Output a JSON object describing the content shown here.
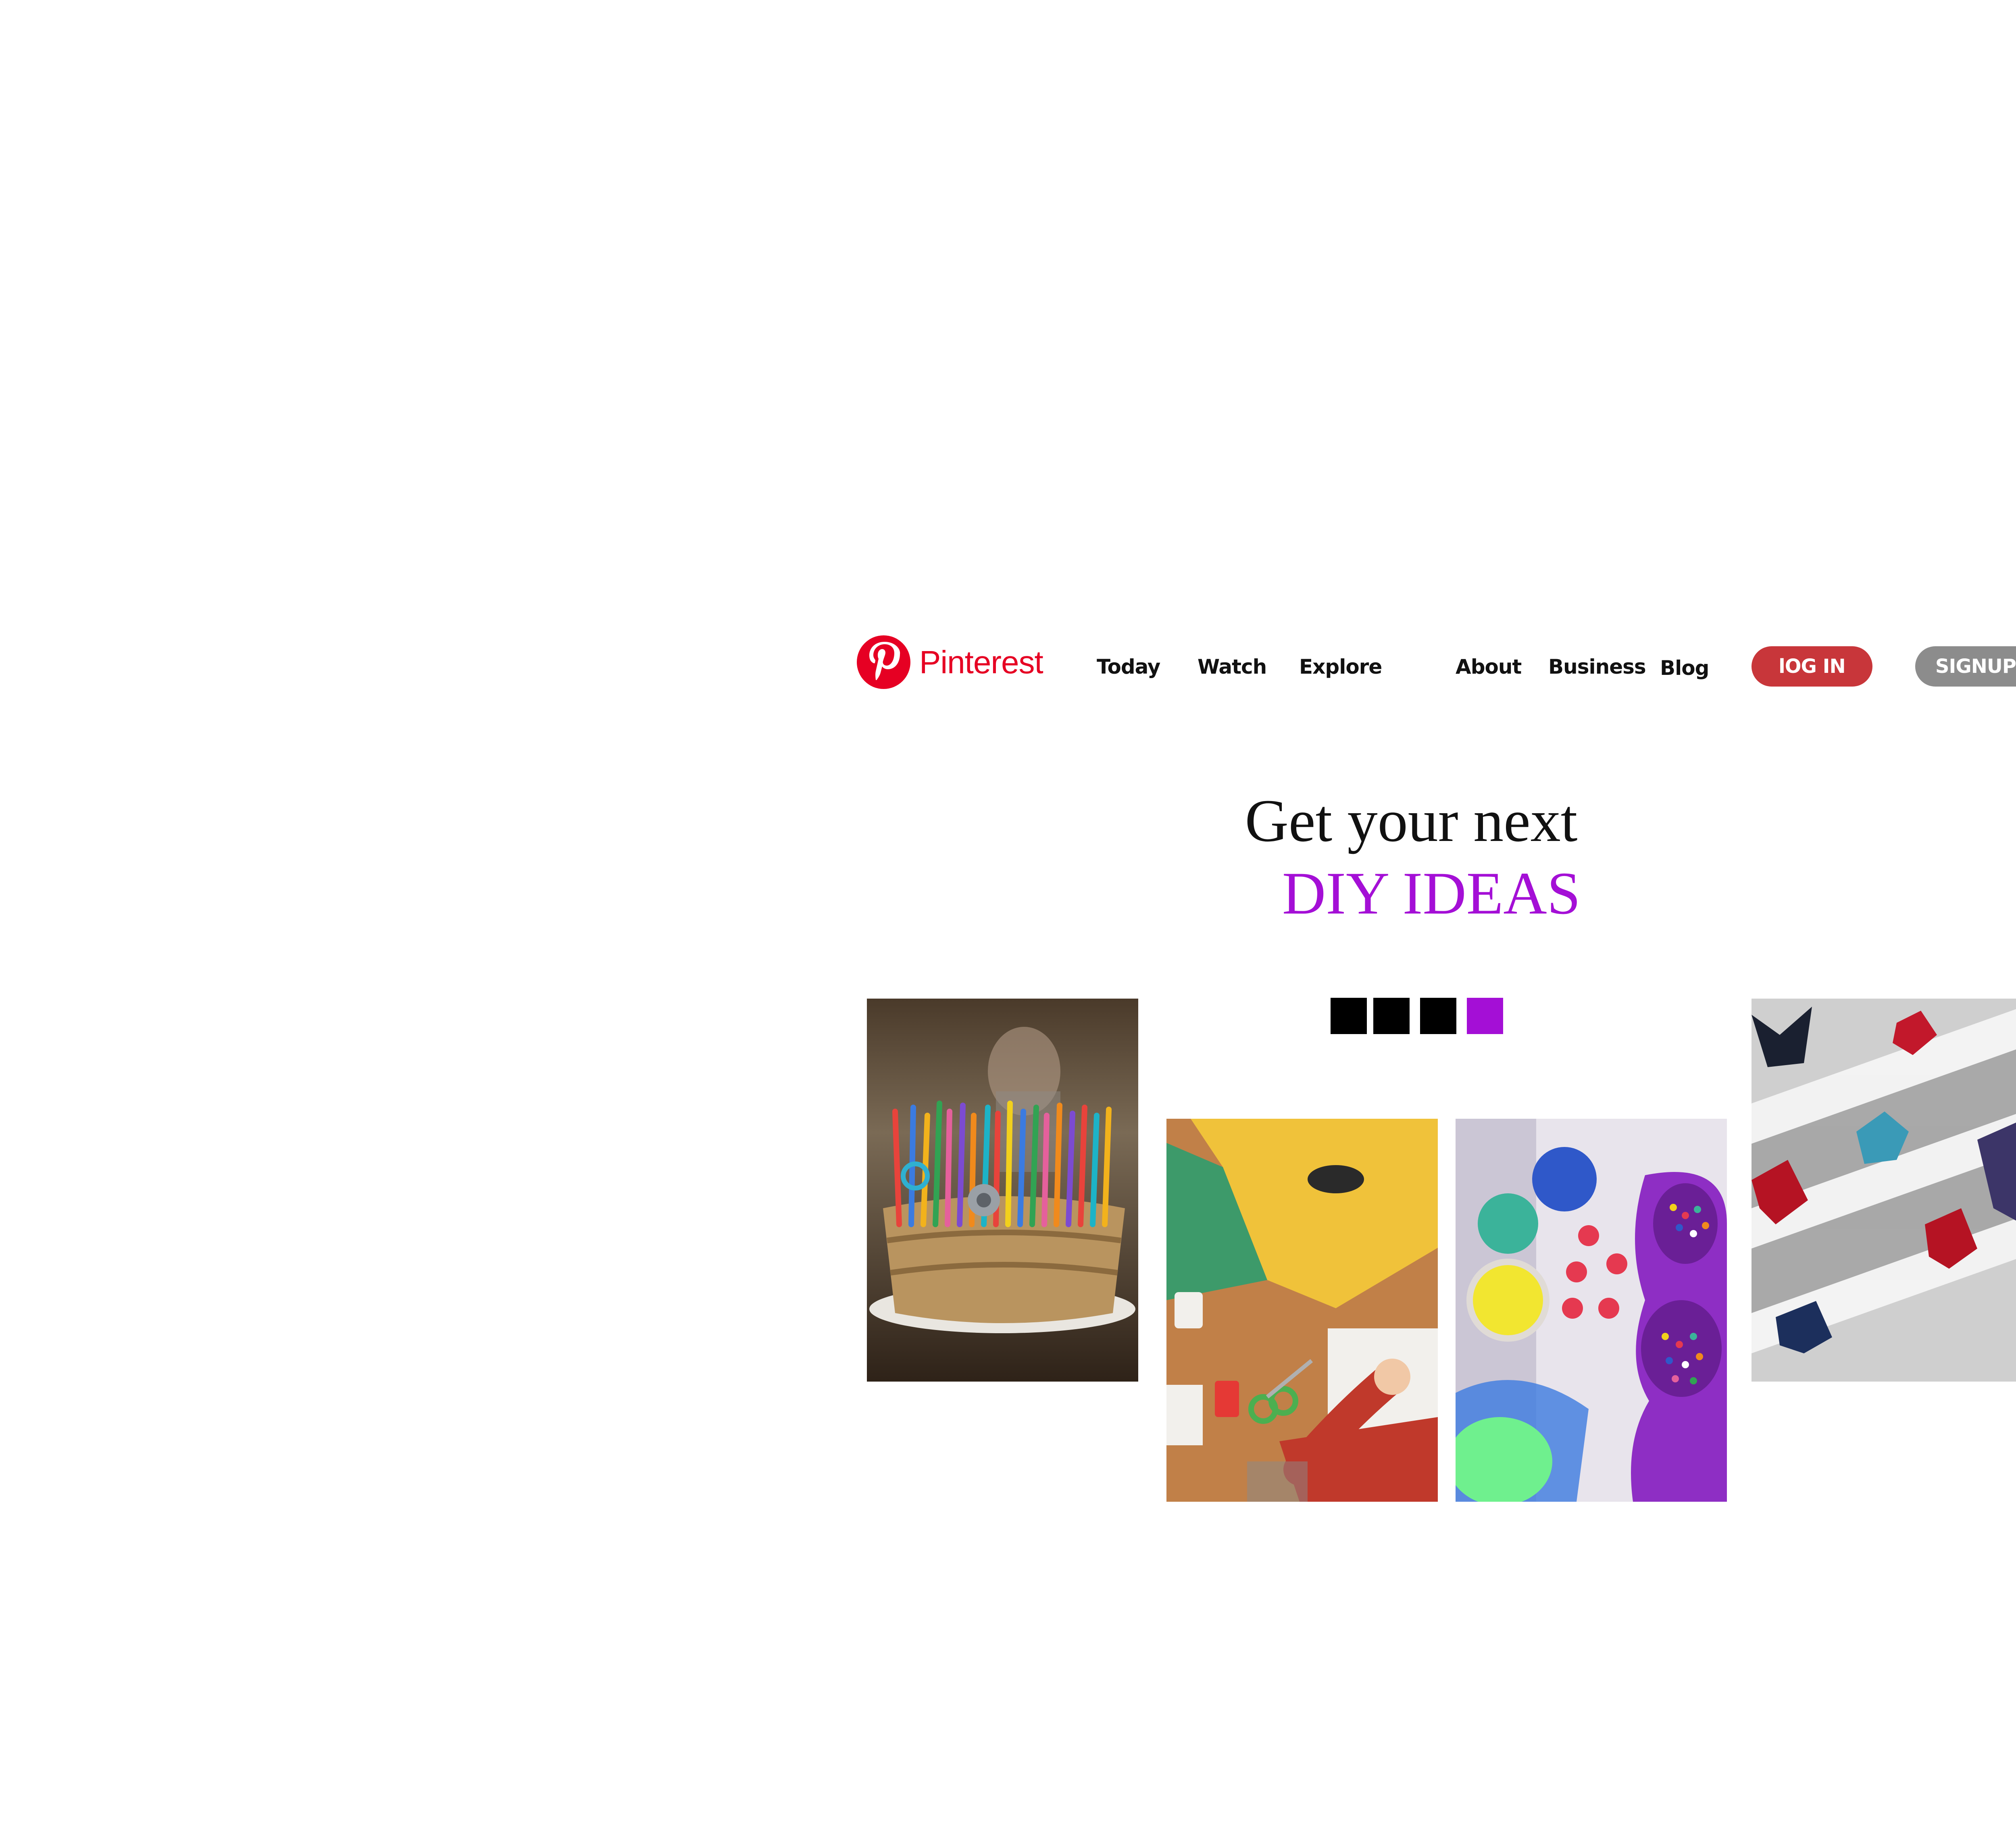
{
  "brand": {
    "name": "Pinterest",
    "color": "#e60023"
  },
  "nav": {
    "today": "Today",
    "watch": "Watch",
    "explore": "Explore",
    "about": "About",
    "business": "Business",
    "blog": "Blog"
  },
  "actions": {
    "login_label": "lOG IN",
    "login_color": "#c8363a",
    "signup_label": "SIGNUP",
    "signup_color": "#8c8c8c"
  },
  "hero": {
    "line1": "Get your next",
    "line2": "DIY IDEAS",
    "accent_color": "#a40fd6"
  },
  "carousel": {
    "dot_count": 4,
    "active_index": 3,
    "inactive_color": "#000000",
    "active_color": "#a40fd6"
  },
  "tiles": [
    {
      "subject": "craft supply basket with pencils and scissors"
    },
    {
      "subject": "child cutting colored paper"
    },
    {
      "subject": "paint pots and beads"
    },
    {
      "subject": "origami flowers and cranes"
    }
  ]
}
